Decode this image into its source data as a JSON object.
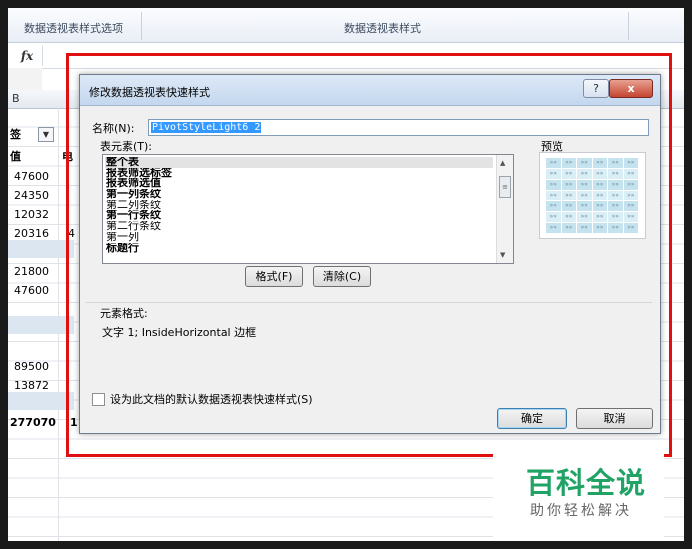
{
  "ribbon": {
    "group_options": "数据透视表样式选项",
    "group_styles": "数据透视表样式"
  },
  "formula_bar": {
    "fx": "fx"
  },
  "column_header": {
    "col_b": "B"
  },
  "sheet": {
    "dropdown_fragment": "签",
    "header_value": "值",
    "header_fragment": "电",
    "values": [
      "47600",
      "24350",
      "12032",
      "20316",
      "21800",
      "47600",
      "89500",
      "13872",
      "277070"
    ],
    "partial_chars": [
      "4",
      "1"
    ]
  },
  "dialog": {
    "title": "修改数据透视表快速样式",
    "help_label": "?",
    "close_label": "x",
    "name_label": "名称(N):",
    "name_value": "PivotStyleLight6 2",
    "table_elements_label": "表元素(T):",
    "elements": [
      "整个表",
      "报表筛选标签",
      "报表筛选值",
      "第一列条纹",
      "第二列条纹",
      "第一行条纹",
      "第二行条纹",
      "第一列",
      "标题行"
    ],
    "preview_label": "预览",
    "format_button": "格式(F)",
    "clear_button": "清除(C)",
    "element_format_label": "元素格式:",
    "element_format_value": "文字 1; InsideHorizontal 边框",
    "default_checkbox_label": "设为此文档的默认数据透视表快速样式(S)",
    "ok_button": "确定",
    "cancel_button": "取消"
  },
  "watermark": {
    "main": "百科全说",
    "sub": "助你轻松解决"
  },
  "colors": {
    "highlight_border": "#e01010",
    "watermark_green": "#21a366",
    "selection_blue": "#3399ff"
  }
}
